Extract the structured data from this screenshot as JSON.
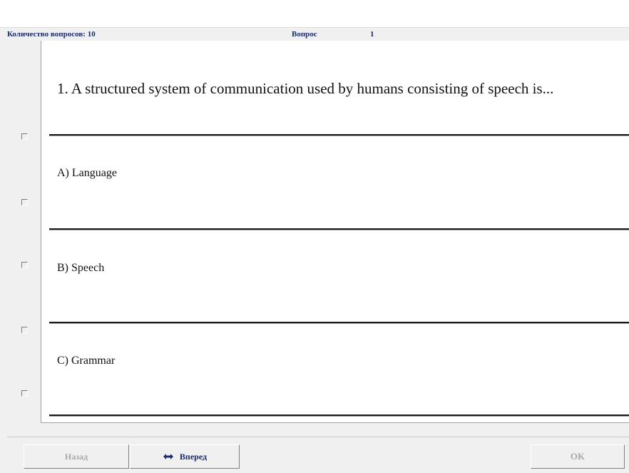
{
  "header": {
    "count_label": "Количество вопросов: 10",
    "question_label": "Вопрос",
    "question_number": "1"
  },
  "question": {
    "text": "1. A structured system of communication used by humans consisting of speech is..."
  },
  "answers": [
    {
      "text": "A) Language"
    },
    {
      "text": "B) Speech"
    },
    {
      "text": "C) Grammar"
    }
  ],
  "checkboxes": [
    {
      "checked": false
    },
    {
      "checked": false
    },
    {
      "checked": false
    },
    {
      "checked": false
    },
    {
      "checked": false
    }
  ],
  "buttons": {
    "back": {
      "label": "Назад",
      "enabled": false
    },
    "forward": {
      "label": "Вперед",
      "enabled": true,
      "icon": "double-arrow-icon"
    },
    "ok": {
      "label": "OK",
      "enabled": false
    }
  },
  "colors": {
    "header_text": "#1a2a6c",
    "disabled_text": "#a8a8a8",
    "window_bg": "#f0f0f0"
  }
}
